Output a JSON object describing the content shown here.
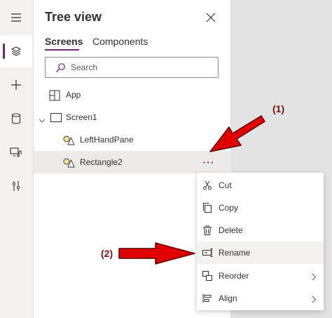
{
  "panel": {
    "title": "Tree view",
    "tabs": [
      "Screens",
      "Components"
    ],
    "search_placeholder": "Search"
  },
  "tree": {
    "app_label": "App",
    "screen_label": "Screen1",
    "children": [
      "LeftHandPane",
      "Rectangle2"
    ],
    "more_label": "···"
  },
  "menu": {
    "items": [
      {
        "label": "Cut",
        "icon": "scissors-icon"
      },
      {
        "label": "Copy",
        "icon": "copy-icon"
      },
      {
        "label": "Delete",
        "icon": "trash-icon"
      },
      {
        "label": "Rename",
        "icon": "rename-icon"
      },
      {
        "label": "Reorder",
        "icon": "reorder-icon"
      },
      {
        "label": "Align",
        "icon": "align-icon"
      }
    ]
  },
  "annotations": {
    "first": "(1)",
    "second": "(2)"
  },
  "colors": {
    "accent": "#742774",
    "annotation": "#7a1010",
    "arrow_fill": "#e00000"
  }
}
